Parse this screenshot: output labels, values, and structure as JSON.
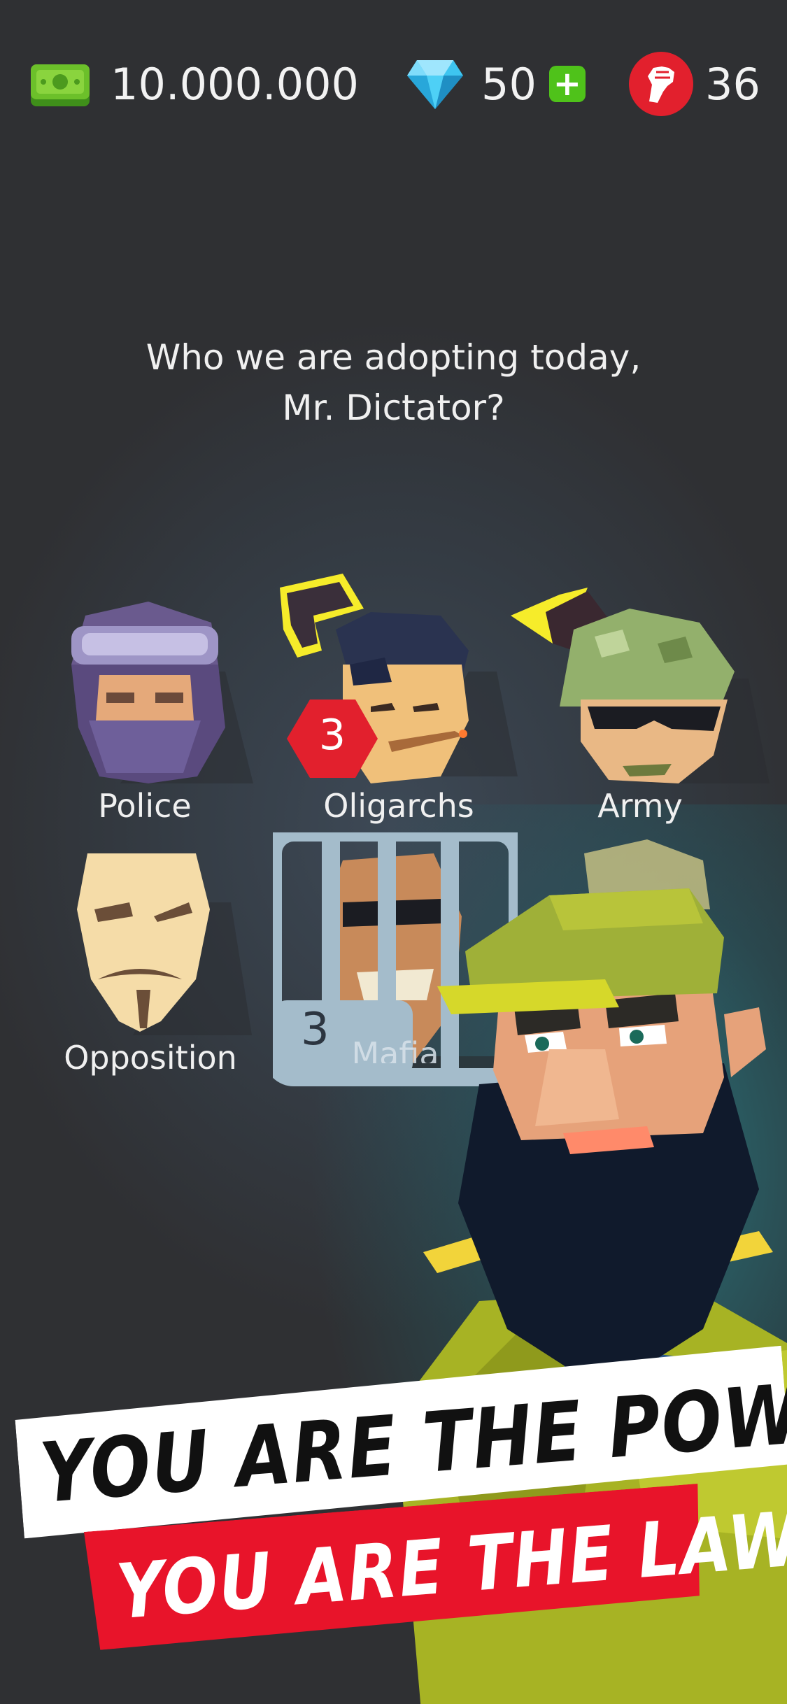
{
  "hud": {
    "money": "10.000.000",
    "gems": "50",
    "gems_add": "+",
    "power": "36"
  },
  "question": {
    "line1": "Who we are adopting today,",
    "line2": "Mr. Dictator?"
  },
  "factions": [
    {
      "label": "Police",
      "locked": false
    },
    {
      "label": "Oligarchs",
      "badge": "3",
      "locked": false
    },
    {
      "label": "Army",
      "locked": false
    },
    {
      "label": "Opposition",
      "locked": false
    },
    {
      "label": "Mafia",
      "locked": true,
      "lock_count": "3"
    }
  ],
  "banner": {
    "line1": "YOU ARE THE POWER!",
    "line2": "YOU ARE THE LAW!"
  },
  "colors": {
    "background": "#2f3033",
    "money_green": "#6cc02a",
    "gem_blue": "#3ec5f0",
    "power_red": "#e2202d",
    "banner_red": "#e8142a",
    "banner_white": "#ffffff"
  },
  "icons": [
    "cash-icon",
    "diamond-icon",
    "fist-icon",
    "pistol-icon",
    "grenade-icon"
  ]
}
